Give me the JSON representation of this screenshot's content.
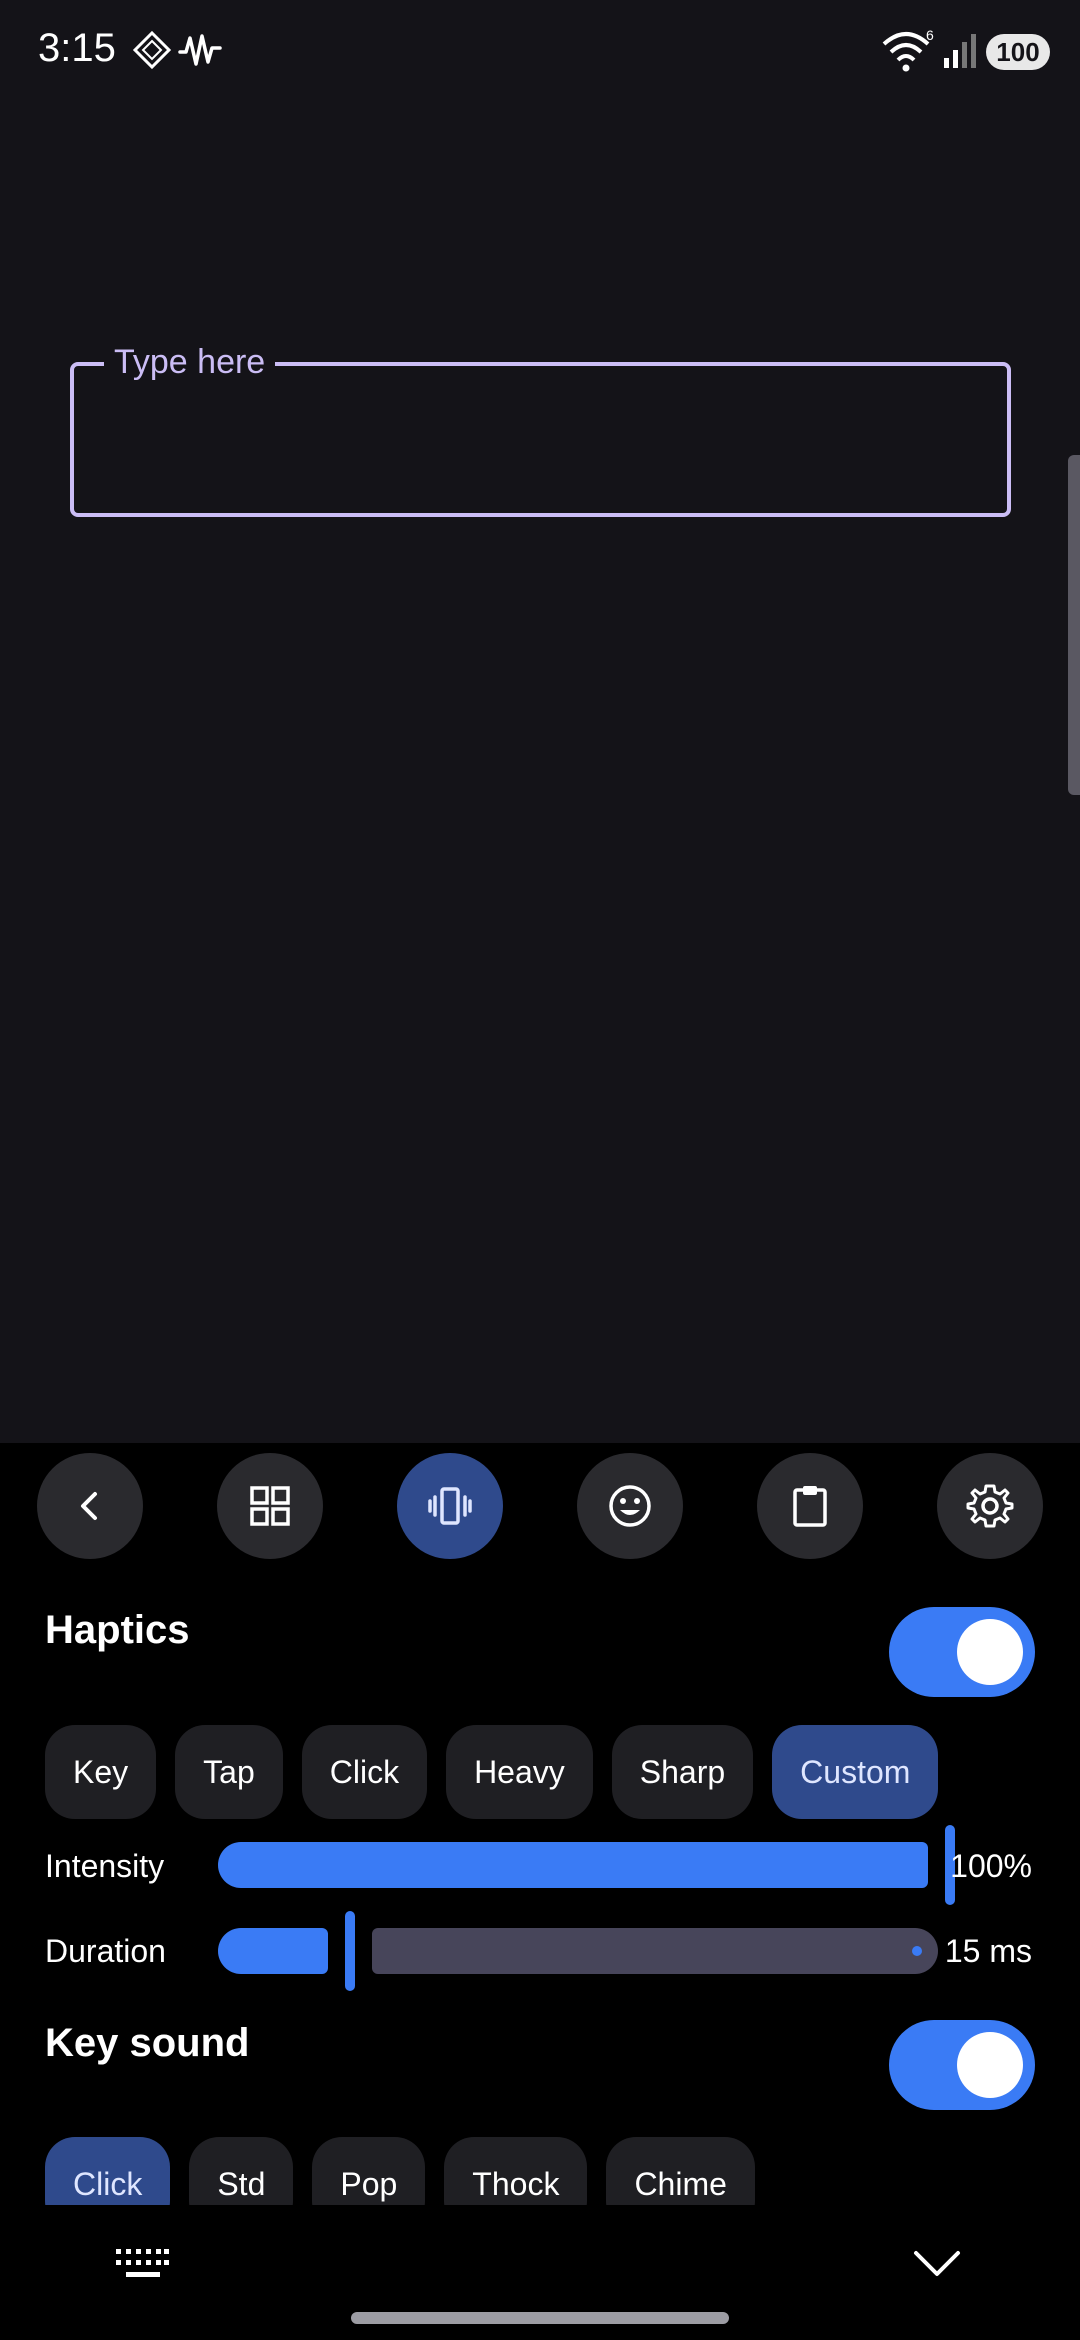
{
  "status_bar": {
    "time": "3:15",
    "battery": "100",
    "network_label": "6"
  },
  "input": {
    "label": "Type here"
  },
  "toolbar": {
    "buttons": [
      "back-icon",
      "grid-icon",
      "vibration-icon",
      "emoji-icon",
      "clipboard-icon",
      "settings-icon"
    ],
    "active": "vibration-icon"
  },
  "haptics": {
    "title": "Haptics",
    "enabled": true,
    "presets": [
      "Key",
      "Tap",
      "Click",
      "Heavy",
      "Sharp",
      "Custom"
    ],
    "selected_preset": "Custom",
    "intensity": {
      "label": "Intensity",
      "value_text": "100%",
      "value": 1.0
    },
    "duration": {
      "label": "Duration",
      "value_text": "15 ms",
      "value": 0.2
    }
  },
  "key_sound": {
    "title": "Key sound",
    "enabled": true,
    "presets": [
      "Click",
      "Std",
      "Pop",
      "Thock",
      "Chime"
    ],
    "selected_preset": "Click"
  },
  "colors": {
    "accent": "#3a7bf5",
    "input_border": "#cbbdf5",
    "chip_selected": "#2f4a8c"
  }
}
